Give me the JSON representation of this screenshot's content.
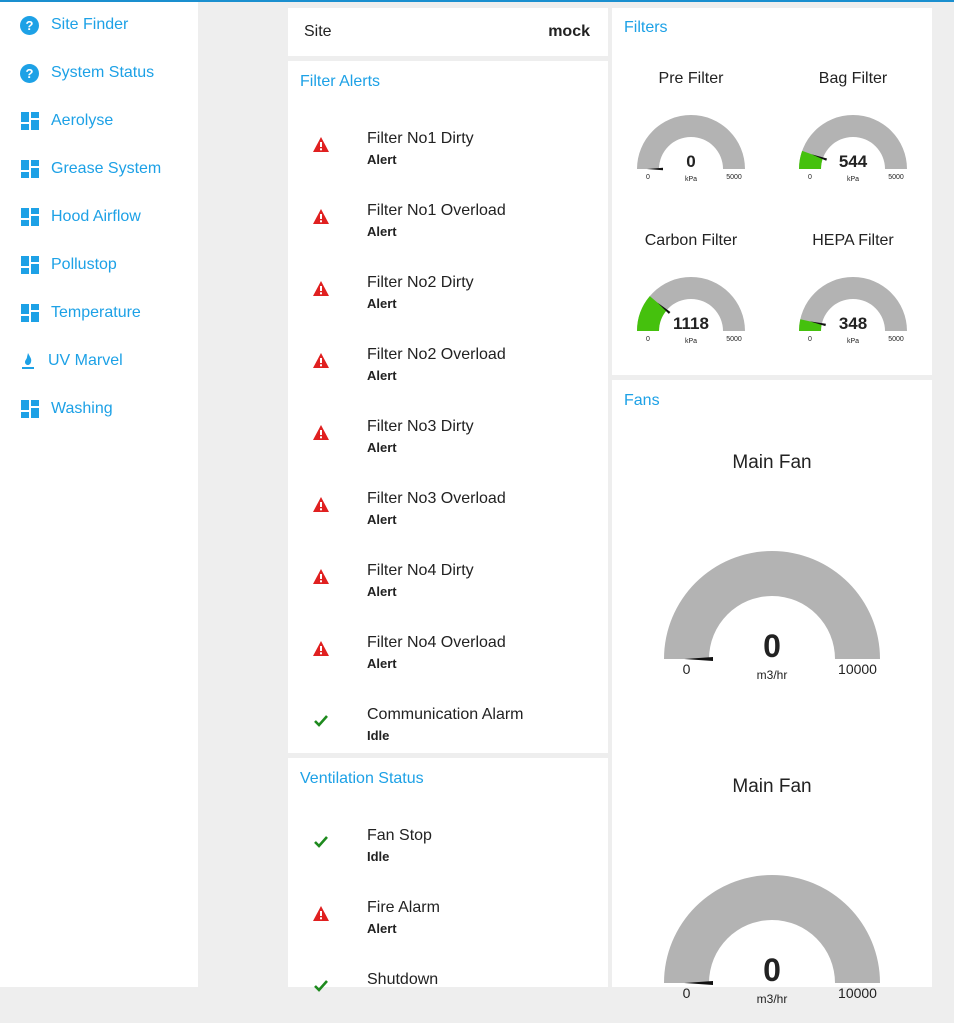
{
  "sidebar": {
    "items": [
      {
        "label": "Site Finder",
        "icon": "help-circle-icon"
      },
      {
        "label": "System Status",
        "icon": "help-circle-icon"
      },
      {
        "label": "Aerolyse",
        "icon": "dashboard-icon"
      },
      {
        "label": "Grease System",
        "icon": "dashboard-icon"
      },
      {
        "label": "Hood Airflow",
        "icon": "dashboard-icon"
      },
      {
        "label": "Pollustop",
        "icon": "dashboard-icon"
      },
      {
        "label": "Temperature",
        "icon": "dashboard-icon"
      },
      {
        "label": "UV Marvel",
        "icon": "uv-flame-icon"
      },
      {
        "label": "Washing",
        "icon": "dashboard-icon"
      }
    ]
  },
  "site": {
    "label": "Site",
    "value": "mock"
  },
  "filter_alerts": {
    "title": "Filter Alerts",
    "rows": [
      {
        "name": "Filter No1 Dirty",
        "status": "Alert",
        "state": "alert"
      },
      {
        "name": "Filter No1 Overload",
        "status": "Alert",
        "state": "alert"
      },
      {
        "name": "Filter No2 Dirty",
        "status": "Alert",
        "state": "alert"
      },
      {
        "name": "Filter No2 Overload",
        "status": "Alert",
        "state": "alert"
      },
      {
        "name": "Filter No3 Dirty",
        "status": "Alert",
        "state": "alert"
      },
      {
        "name": "Filter No3 Overload",
        "status": "Alert",
        "state": "alert"
      },
      {
        "name": "Filter No4 Dirty",
        "status": "Alert",
        "state": "alert"
      },
      {
        "name": "Filter No4 Overload",
        "status": "Alert",
        "state": "alert"
      },
      {
        "name": "Communication Alarm",
        "status": "Idle",
        "state": "ok"
      }
    ]
  },
  "ventilation_status": {
    "title": "Ventilation Status",
    "rows": [
      {
        "name": "Fan Stop",
        "status": "Idle",
        "state": "ok"
      },
      {
        "name": "Fire Alarm",
        "status": "Alert",
        "state": "alert"
      },
      {
        "name": "Shutdown",
        "status": "",
        "state": "ok"
      }
    ]
  },
  "filters": {
    "title": "Filters",
    "gauges": [
      {
        "title": "Pre Filter",
        "value": 0,
        "value_text": "0",
        "min": 0,
        "max": 5000,
        "min_text": "0",
        "max_text": "5000",
        "unit": "kPa"
      },
      {
        "title": "Bag Filter",
        "value": 544,
        "value_text": "544",
        "min": 0,
        "max": 5000,
        "min_text": "0",
        "max_text": "5000",
        "unit": "kPa"
      },
      {
        "title": "Carbon Filter",
        "value": 1118,
        "value_text": "1118",
        "min": 0,
        "max": 5000,
        "min_text": "0",
        "max_text": "5000",
        "unit": "kPa"
      },
      {
        "title": "HEPA Filter",
        "value": 348,
        "value_text": "348",
        "min": 0,
        "max": 5000,
        "min_text": "0",
        "max_text": "5000",
        "unit": "kPa"
      }
    ]
  },
  "fans": {
    "title": "Fans",
    "gauges": [
      {
        "title": "Main Fan",
        "value": 0,
        "value_text": "0",
        "min": 0,
        "max": 10000,
        "min_text": "0",
        "max_text": "10000",
        "unit": "m3/hr"
      },
      {
        "title": "Main Fan",
        "value": 0,
        "value_text": "0",
        "min": 0,
        "max": 10000,
        "min_text": "0",
        "max_text": "10000",
        "unit": "m3/hr"
      }
    ]
  },
  "colors": {
    "accent": "#1da1e6",
    "alert": "#e02020",
    "ok": "#1e8a1e",
    "gauge_track": "#b3b3b3",
    "gauge_fill": "#45c10d"
  }
}
